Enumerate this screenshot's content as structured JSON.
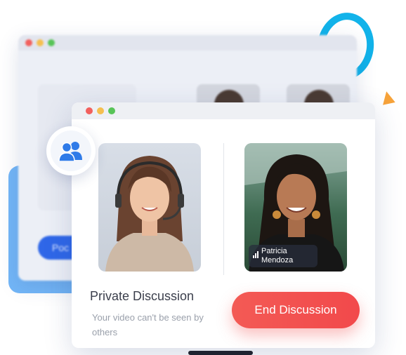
{
  "front_window": {
    "title": "Private Discussion",
    "subtitle": "Your video can't be seen by others",
    "end_button_label": "End Discussion"
  },
  "participant_right": {
    "name": "Patricia Mendoza"
  },
  "colors": {
    "accent_red": "#f2494b",
    "accent_blue": "#2f7be8",
    "ring_cyan": "#12b3ea",
    "triangle_orange": "#f7a33a"
  },
  "icons": {
    "participants": "users-icon",
    "signal": "signal-bars-icon"
  }
}
